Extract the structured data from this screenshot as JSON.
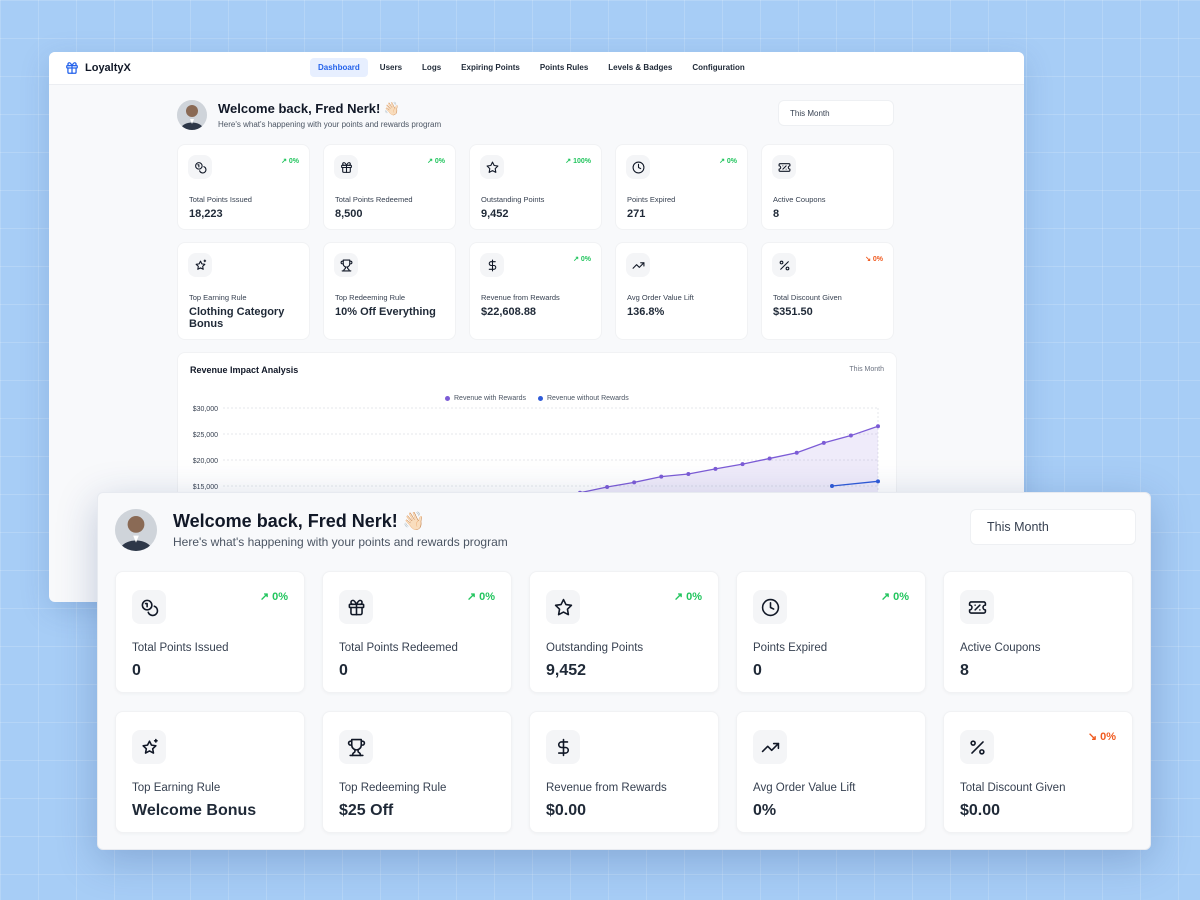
{
  "app": {
    "name": "LoyaltyX"
  },
  "nav": {
    "items": [
      {
        "label": "Dashboard",
        "active": true
      },
      {
        "label": "Users"
      },
      {
        "label": "Logs"
      },
      {
        "label": "Expiring Points"
      },
      {
        "label": "Points Rules"
      },
      {
        "label": "Levels & Badges"
      },
      {
        "label": "Configuration"
      }
    ]
  },
  "back": {
    "welcome_title": "Welcome back, Fred Nerk! 👋🏻",
    "welcome_sub": "Here's what's happening with your points and rewards program",
    "period": "This Month",
    "cards_row1": [
      {
        "icon": "coins-icon",
        "trend": "↗ 0%",
        "label": "Total Points Issued",
        "value": "18,223"
      },
      {
        "icon": "gift-icon",
        "trend": "↗ 0%",
        "label": "Total Points Redeemed",
        "value": "8,500"
      },
      {
        "icon": "star-icon",
        "trend": "↗ 100%",
        "label": "Outstanding Points",
        "value": "9,452"
      },
      {
        "icon": "clock-icon",
        "trend": "↗ 0%",
        "label": "Points Expired",
        "value": "271"
      },
      {
        "icon": "ticket-icon",
        "trend": "",
        "label": "Active Coupons",
        "value": "8"
      }
    ],
    "cards_row2": [
      {
        "icon": "sparkle-star-icon",
        "trend": "",
        "label": "Top Earning Rule",
        "value": "Clothing Category Bonus"
      },
      {
        "icon": "trophy-icon",
        "trend": "",
        "label": "Top Redeeming Rule",
        "value": "10% Off Everything"
      },
      {
        "icon": "dollar-icon",
        "trend": "↗ 0%",
        "label": "Revenue from Rewards",
        "value": "$22,608.88"
      },
      {
        "icon": "trending-up-icon",
        "trend": "",
        "label": "Avg Order Value Lift",
        "value": "136.8%"
      },
      {
        "icon": "percent-icon",
        "trend": "↘ 0%",
        "label": "Total Discount Given",
        "value": "$351.50"
      }
    ]
  },
  "chart_card": {
    "title": "Revenue Impact Analysis",
    "period": "This Month"
  },
  "chart_data": {
    "type": "line",
    "title": "Revenue Impact Analysis",
    "ylim": [
      0,
      30000
    ],
    "yticks": [
      "$30,000",
      "$25,000",
      "$20,000",
      "$15,000"
    ],
    "series": [
      {
        "name": "Revenue with Rewards",
        "color": "#7c5cd6",
        "values": [
          13700,
          14800,
          15700,
          16800,
          17300,
          18300,
          19200,
          20300,
          21400,
          23300,
          24700,
          26500
        ]
      },
      {
        "name": "Revenue without Rewards",
        "color": "#2f5bd8",
        "values": [
          15000,
          15900
        ]
      }
    ]
  },
  "front": {
    "welcome_title": "Welcome back, Fred Nerk! 👋🏻",
    "welcome_sub": "Here's what's happening with your points and rewards program",
    "period": "This Month",
    "cards_row1": [
      {
        "icon": "coins-icon",
        "trend": "↗ 0%",
        "label": "Total Points Issued",
        "value": "0"
      },
      {
        "icon": "gift-icon",
        "trend": "↗ 0%",
        "label": "Total Points Redeemed",
        "value": "0"
      },
      {
        "icon": "star-icon",
        "trend": "↗ 0%",
        "label": "Outstanding Points",
        "value": "9,452"
      },
      {
        "icon": "clock-icon",
        "trend": "↗ 0%",
        "label": "Points Expired",
        "value": "0"
      },
      {
        "icon": "ticket-icon",
        "trend": "",
        "label": "Active Coupons",
        "value": "8"
      }
    ],
    "cards_row2": [
      {
        "icon": "sparkle-star-icon",
        "trend": "",
        "label": "Top Earning Rule",
        "value": "Welcome Bonus"
      },
      {
        "icon": "trophy-icon",
        "trend": "",
        "label": "Top Redeeming Rule",
        "value": "$25 Off"
      },
      {
        "icon": "dollar-icon",
        "trend": "",
        "label": "Revenue from Rewards",
        "value": "$0.00"
      },
      {
        "icon": "trending-up-icon",
        "trend": "",
        "label": "Avg Order Value Lift",
        "value": "0%"
      },
      {
        "icon": "percent-icon",
        "trend": "↘ 0%",
        "label": "Total Discount Given",
        "value": "$0.00"
      }
    ]
  }
}
